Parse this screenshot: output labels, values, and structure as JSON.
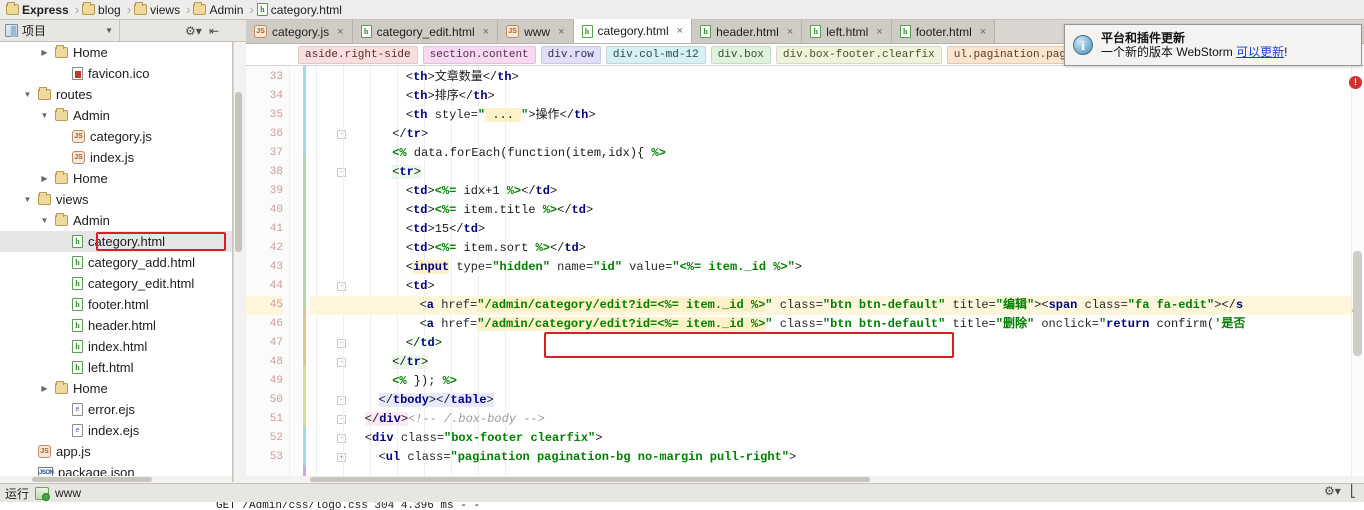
{
  "app": {
    "name": "WebStorm"
  },
  "breadcrumb": {
    "items": [
      {
        "label": "Express",
        "icon": "folder-icon",
        "bold": true
      },
      {
        "label": "blog",
        "icon": "folder-icon",
        "bold": false
      },
      {
        "label": "views",
        "icon": "folder-icon",
        "bold": false
      },
      {
        "label": "Admin",
        "icon": "folder-icon",
        "bold": false
      },
      {
        "label": "category.html",
        "icon": "html-file-icon",
        "bold": false
      }
    ],
    "separator": "›"
  },
  "toolbar": {
    "project_label": "项目",
    "project_caret": "▼",
    "gear_icon": "gear-icon",
    "collapse_icon": "collapse-all-icon"
  },
  "tabs": [
    {
      "label": "category.js",
      "icon": "js-file-icon",
      "active": false
    },
    {
      "label": "category_edit.html",
      "icon": "html-file-icon",
      "active": false
    },
    {
      "label": "www",
      "icon": "js-file-icon",
      "active": false
    },
    {
      "label": "category.html",
      "icon": "html-file-icon",
      "active": true
    },
    {
      "label": "header.html",
      "icon": "html-file-icon",
      "active": false
    },
    {
      "label": "left.html",
      "icon": "html-file-icon",
      "active": false
    },
    {
      "label": "footer.html",
      "icon": "html-file-icon",
      "active": false
    }
  ],
  "tab_close_glyph": "×",
  "css_path": [
    {
      "label": "aside.right-side",
      "bg": "#f9dede",
      "fg": "#5a2b2b"
    },
    {
      "label": "section.content",
      "bg": "#f7d9f2",
      "fg": "#5a2b52"
    },
    {
      "label": "div.row",
      "bg": "#e0dff7",
      "fg": "#2e2b5a"
    },
    {
      "label": "div.col-md-12",
      "bg": "#d7f0f4",
      "fg": "#1f4a52"
    },
    {
      "label": "div.box",
      "bg": "#dff2dc",
      "fg": "#2b5227"
    },
    {
      "label": "div.box-footer.clearfix",
      "bg": "#eef3dc",
      "fg": "#4a5227"
    },
    {
      "label": "ul.pagination.pagination-bg.no-margin.pull-right",
      "bg": "#fae3cf",
      "fg": "#5a3b1f"
    }
  ],
  "tree": [
    {
      "label": "Home",
      "icon": "folder-icon",
      "indent": 3,
      "arrow": "▶",
      "selected": false
    },
    {
      "label": "favicon.ico",
      "icon": "ico-file-icon",
      "indent": 4,
      "arrow": "",
      "selected": false
    },
    {
      "label": "routes",
      "icon": "folder-icon",
      "indent": 2,
      "arrow": "▼",
      "selected": false
    },
    {
      "label": "Admin",
      "icon": "folder-icon",
      "indent": 3,
      "arrow": "▼",
      "selected": false
    },
    {
      "label": "category.js",
      "icon": "js-file-icon",
      "indent": 4,
      "arrow": "",
      "selected": false
    },
    {
      "label": "index.js",
      "icon": "js-file-icon",
      "indent": 4,
      "arrow": "",
      "selected": false
    },
    {
      "label": "Home",
      "icon": "folder-icon",
      "indent": 3,
      "arrow": "▶",
      "selected": false
    },
    {
      "label": "views",
      "icon": "folder-icon",
      "indent": 2,
      "arrow": "▼",
      "selected": false
    },
    {
      "label": "Admin",
      "icon": "folder-icon",
      "indent": 3,
      "arrow": "▼",
      "selected": false
    },
    {
      "label": "category.html",
      "icon": "html-file-icon",
      "indent": 4,
      "arrow": "",
      "selected": true
    },
    {
      "label": "category_add.html",
      "icon": "html-file-icon",
      "indent": 4,
      "arrow": "",
      "selected": false
    },
    {
      "label": "category_edit.html",
      "icon": "html-file-icon",
      "indent": 4,
      "arrow": "",
      "selected": false
    },
    {
      "label": "footer.html",
      "icon": "html-file-icon",
      "indent": 4,
      "arrow": "",
      "selected": false
    },
    {
      "label": "header.html",
      "icon": "html-file-icon",
      "indent": 4,
      "arrow": "",
      "selected": false
    },
    {
      "label": "index.html",
      "icon": "html-file-icon",
      "indent": 4,
      "arrow": "",
      "selected": false
    },
    {
      "label": "left.html",
      "icon": "html-file-icon",
      "indent": 4,
      "arrow": "",
      "selected": false
    },
    {
      "label": "Home",
      "icon": "folder-icon",
      "indent": 3,
      "arrow": "▶",
      "selected": false
    },
    {
      "label": "error.ejs",
      "icon": "ejs-file-icon",
      "indent": 4,
      "arrow": "",
      "selected": false
    },
    {
      "label": "index.ejs",
      "icon": "ejs-file-icon",
      "indent": 4,
      "arrow": "",
      "selected": false
    },
    {
      "label": "app.js",
      "icon": "js-file-icon",
      "indent": 2,
      "arrow": "",
      "selected": false
    },
    {
      "label": "package.json",
      "icon": "json-file-icon",
      "indent": 2,
      "arrow": "",
      "selected": false
    }
  ],
  "editor": {
    "first_line": 33,
    "highlighted_line": 45,
    "lines": [
      {
        "n": 33,
        "indent": 14,
        "html": "<span class='punct'>&lt;</span><span class='tag'>th</span><span class='punct'>&gt;</span><span class='txt'>文章数量</span><span class='punct'>&lt;/</span><span class='tag'>th</span><span class='punct'>&gt;</span>"
      },
      {
        "n": 34,
        "indent": 14,
        "html": "<span class='punct'>&lt;</span><span class='tag'>th</span><span class='punct'>&gt;</span><span class='txt'>排序</span><span class='punct'>&lt;/</span><span class='tag'>th</span><span class='punct'>&gt;</span>"
      },
      {
        "n": 35,
        "indent": 14,
        "html": "<span class='punct'>&lt;</span><span class='tag'>th</span> <span class='att'>style=</span><span class='val'>\"</span><span class='yellowhl'>&nbsp;...&nbsp;</span><span class='val'>\"</span><span class='punct'>&gt;</span><span class='txt'>操作</span><span class='punct'>&lt;/</span><span class='tag'>th</span><span class='punct'>&gt;</span>"
      },
      {
        "n": 36,
        "indent": 12,
        "html": "<span class='punct'>&lt;/</span><span class='tag'>tr</span><span class='punct'>&gt;</span>"
      },
      {
        "n": 37,
        "indent": 12,
        "html": "<span class='ejs'>&lt;%</span> <span class='plain'>data.forEach(function(item,idx){</span> <span class='ejs'>%&gt;</span>"
      },
      {
        "n": 38,
        "indent": 12,
        "html": "<span class='greenhl'><span class='punct'>&lt;</span><span class='tag'>tr</span><span class='punct'>&gt;</span></span>"
      },
      {
        "n": 39,
        "indent": 14,
        "html": "<span class='punct'>&lt;</span><span class='tag'>td</span><span class='punct'>&gt;</span><span class='ejs'>&lt;%=</span> <span class='plain'>idx+1</span> <span class='ejs'>%&gt;</span><span class='punct'>&lt;/</span><span class='tag'>td</span><span class='punct'>&gt;</span>"
      },
      {
        "n": 40,
        "indent": 14,
        "html": "<span class='punct'>&lt;</span><span class='tag'>td</span><span class='punct'>&gt;</span><span class='ejs'>&lt;%=</span> <span class='plain'>item.title</span> <span class='ejs'>%&gt;</span><span class='punct'>&lt;/</span><span class='tag'>td</span><span class='punct'>&gt;</span>"
      },
      {
        "n": 41,
        "indent": 14,
        "html": "<span class='punct'>&lt;</span><span class='tag'>td</span><span class='punct'>&gt;</span><span class='txt'>15</span><span class='punct'>&lt;/</span><span class='tag'>td</span><span class='punct'>&gt;</span>"
      },
      {
        "n": 42,
        "indent": 14,
        "html": "<span class='punct'>&lt;</span><span class='tag'>td</span><span class='punct'>&gt;</span><span class='ejs'>&lt;%=</span> <span class='plain'>item.sort</span> <span class='ejs'>%&gt;</span><span class='punct'>&lt;/</span><span class='tag'>td</span><span class='punct'>&gt;</span>"
      },
      {
        "n": 43,
        "indent": 14,
        "html": "<span class='punct'>&lt;</span><span class='tag yellowhl'>input</span> <span class='att'>type=</span><span class='val'>\"hidden\"</span> <span class='att'>name=</span><span class='val'>\"id\"</span> <span class='att'>value=</span><span class='val'>\"</span><span class='ejs'>&lt;%=</span> <span class='ejs'>item._id</span> <span class='ejs'>%&gt;</span><span class='val'>\"</span><span class='punct'>&gt;</span>"
      },
      {
        "n": 44,
        "indent": 14,
        "html": "<span class='punct'>&lt;</span><span class='tag'>td</span><span class='punct'>&gt;</span>"
      },
      {
        "n": 45,
        "indent": 16,
        "html": "<span class='punct'>&lt;</span><span class='tag'>a</span> <span class='att'>href=</span><span class='val yellowhl'>\"/admin/category/edit?id=</span><span class='ejs yellowhl'>&lt;%= item._id %&gt;</span><span class='val'>\"</span> <span class='att'>class=</span><span class='val'>\"btn btn-default\"</span> <span class='att'>title=</span><span class='val'>\"编辑\"</span><span class='punct'>&gt;&lt;</span><span class='tag'>span</span> <span class='att'>class=</span><span class='val'>\"fa fa-edit\"</span><span class='punct'>&gt;&lt;/</span><span class='tag'>s</span>"
      },
      {
        "n": 46,
        "indent": 16,
        "html": "<span class='punct'>&lt;</span><span class='tag'>a</span> <span class='att'>href=</span><span class='val yellowhl'>\"/admin/category/edit?id=</span><span class='ejs yellowhl'>&lt;%= item._id %&gt;</span><span class='val'>\"</span> <span class='att'>class=</span><span class='val'>\"btn btn-default\"</span> <span class='att'>title=</span><span class='val'>\"删除\"</span> <span class='att'>onclick=</span><span class='val'>\"</span><span class='kw'>return</span> <span class='plain'>confirm(</span><span class='val'>'是否</span>"
      },
      {
        "n": 47,
        "indent": 14,
        "html": "<span class='tdhl'><span class='punct'>&lt;/</span><span class='tag'>td</span><span class='punct'>&gt;</span></span>"
      },
      {
        "n": 48,
        "indent": 12,
        "html": "<span class='greenhl'><span class='punct'>&lt;/</span><span class='tag'>tr</span><span class='punct'>&gt;</span></span>"
      },
      {
        "n": 49,
        "indent": 12,
        "html": "<span class='ejs'>&lt;%</span> <span class='plain'>});</span> <span class='ejs'>%&gt;</span>"
      },
      {
        "n": 50,
        "indent": 10,
        "html": "<span class='bluehl'><span class='punct'>&lt;/</span><span class='tag'>tbody</span><span class='punct'>&gt;&lt;/</span><span class='tag'>table</span><span class='punct'>&gt;</span></span>"
      },
      {
        "n": 51,
        "indent": 8,
        "html": "<span class='pinkhl'><span class='punct'>&lt;/</span><span class='tag'>div</span><span class='punct'>&gt;</span></span><span class='cmt'>&lt;!-- /.box-body --&gt;</span>"
      },
      {
        "n": 52,
        "indent": 8,
        "html": "<span class='punct'>&lt;</span><span class='tag'>div</span> <span class='att'>class=</span><span class='val'>\"box-footer clearfix\"</span><span class='punct'>&gt;</span>"
      },
      {
        "n": 53,
        "indent": 10,
        "html": "<span class='punct'>&lt;</span><span class='tag'>ul</span> <span class='att'>class=</span><span class='val'>\"pagination pagination-bg no-margin pull-right\"</span><span class='punct'>&gt;</span>"
      }
    ]
  },
  "notification": {
    "icon": "info-icon",
    "title": "平台和插件更新",
    "body_prefix": "一个新的版本 WebStorm ",
    "body_link": "可以更新",
    "body_suffix": "!"
  },
  "statusbar": {
    "run_label": "运行",
    "run_config": "www",
    "gear_icon": "gear-icon",
    "layout_icon": "layout-icon"
  },
  "console": {
    "line": "GET /Admin/css/logo.css 304 4.396 ms - -"
  },
  "markers": {
    "error_count_glyph": "!",
    "error_color": "#cf3030"
  }
}
